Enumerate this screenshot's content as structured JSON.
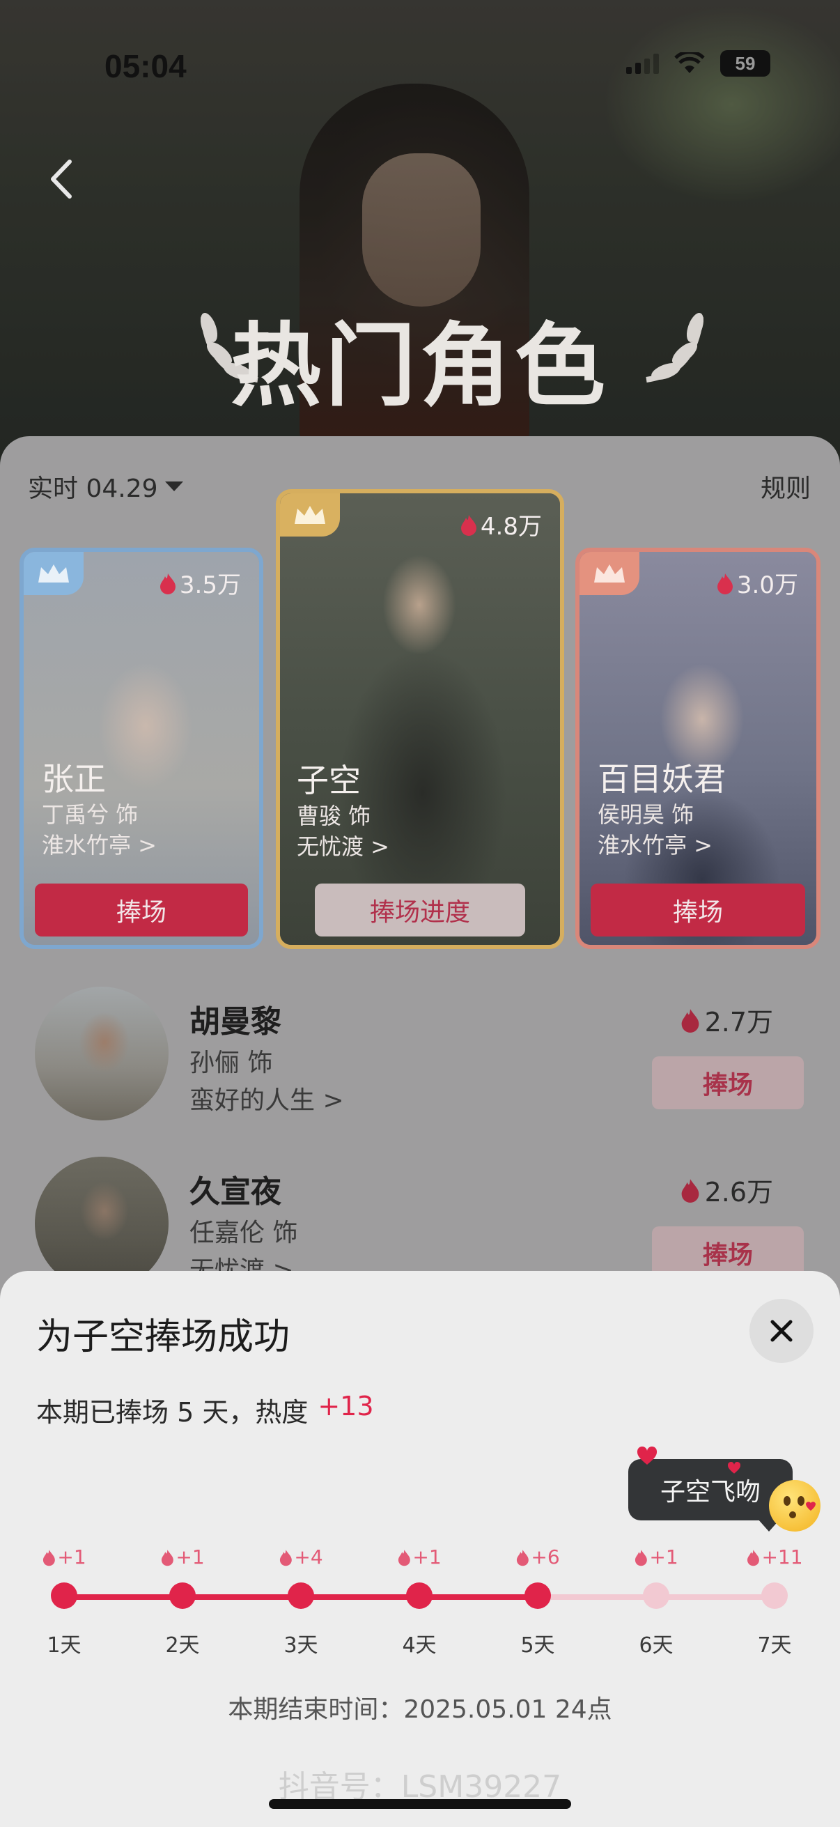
{
  "status_bar": {
    "time": "05:04",
    "battery": "59"
  },
  "header": {
    "title": "热门角色",
    "back_icon": "chevron-left-icon"
  },
  "panel": {
    "date_filter": "实时 04.29",
    "rules_label": "规则"
  },
  "top_cards": [
    {
      "rank_color": "#8ab6dd",
      "heat": "3.5万",
      "name": "张正",
      "actor": "丁禹兮 饰",
      "show": "淮水竹亭 >",
      "button": "捧场"
    },
    {
      "rank_color": "#d9b160",
      "heat": "4.8万",
      "name": "子空",
      "actor": "曹骏 饰",
      "show": "无忧渡 >",
      "button": "捧场进度"
    },
    {
      "rank_color": "#e4927f",
      "heat": "3.0万",
      "name": "百目妖君",
      "actor": "侯明昊 饰",
      "show": "淮水竹亭 >",
      "button": "捧场"
    }
  ],
  "list": [
    {
      "name": "胡曼黎",
      "actor": "孙俪 饰",
      "show": "蛮好的人生 >",
      "heat": "2.7万",
      "button": "捧场"
    },
    {
      "name": "久宣夜",
      "actor": "任嘉伦 饰",
      "show": "无忧渡 >",
      "heat": "2.6万",
      "button": "捧场"
    }
  ],
  "sheet": {
    "title": "为子空捧场成功",
    "info_prefix": "本期已捧场 5 天，热度",
    "info_plus": "+13",
    "bubble": "子空飞吻",
    "days": [
      {
        "plus": "+1",
        "label": "1天",
        "done": true
      },
      {
        "plus": "+1",
        "label": "2天",
        "done": true
      },
      {
        "plus": "+4",
        "label": "3天",
        "done": true
      },
      {
        "plus": "+1",
        "label": "4天",
        "done": true
      },
      {
        "plus": "+6",
        "label": "5天",
        "done": true
      },
      {
        "plus": "+1",
        "label": "6天",
        "done": false
      },
      {
        "plus": "+11",
        "label": "7天",
        "done": false
      }
    ],
    "end_time": "本期结束时间：2025.05.01 24点"
  },
  "watermark": "抖音号：LSM39227",
  "colors": {
    "accent": "#e0244a",
    "accent_light": "#f2c9d2",
    "card_button": "#c22a45"
  }
}
